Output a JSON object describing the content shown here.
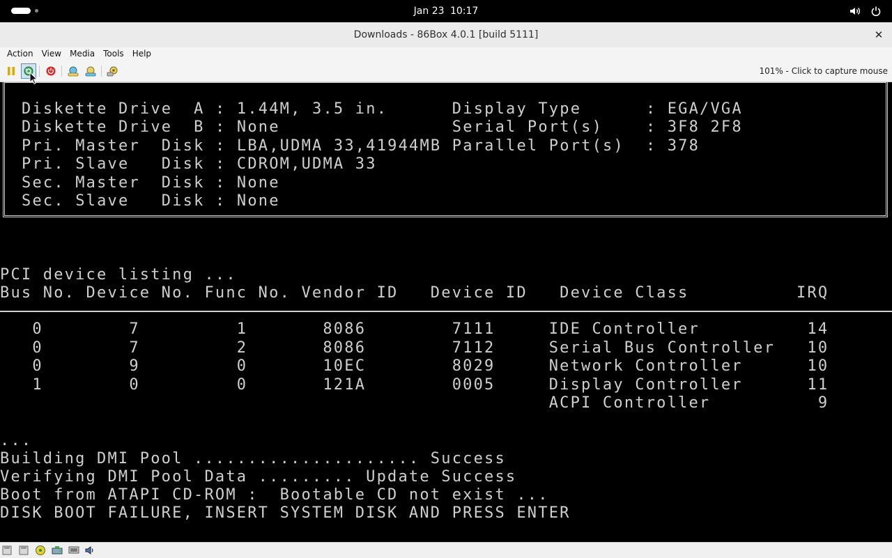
{
  "topbar": {
    "date": "Jan 23",
    "time": "10:17"
  },
  "window": {
    "title": "Downloads - 86Box 4.0.1 [build 5111]",
    "close_label": "✕"
  },
  "menu": [
    "Action",
    "View",
    "Media",
    "Tools",
    "Help"
  ],
  "toolbar": {
    "capture_hint": "101% - Click to capture mouse"
  },
  "bios": {
    "sysinfo": [
      "Diskette Drive  A : 1.44M, 3.5 in.      Display Type      : EGA/VGA",
      "Diskette Drive  B : None                Serial Port(s)    : 3F8 2F8",
      "Pri. Master  Disk : LBA,UDMA 33,41944MB Parallel Port(s)  : 378",
      "Pri. Slave   Disk : CDROM,UDMA 33",
      "Sec. Master  Disk : None",
      "Sec. Slave   Disk : None"
    ],
    "pci_title": "PCI device listing ...",
    "pci_header": "Bus No. Device No. Func No. Vendor ID   Device ID   Device Class          IRQ",
    "pci_rows": [
      "   0        7         1       8086        7111     IDE Controller          14",
      "   0        7         2       8086        7112     Serial Bus Controller   10",
      "   0        9         0       10EC        8029     Network Controller      10",
      "   1        0         0       121A        0005     Display Controller      11",
      "                                                   ACPI Controller          9"
    ],
    "boot_lines": [
      "...",
      "Building DMI Pool ..................... Success",
      "Verifying DMI Pool Data ......... Update Success",
      "Boot from ATAPI CD-ROM :  Bootable CD not exist ...",
      "DISK BOOT FAILURE, INSERT SYSTEM DISK AND PRESS ENTER"
    ]
  }
}
